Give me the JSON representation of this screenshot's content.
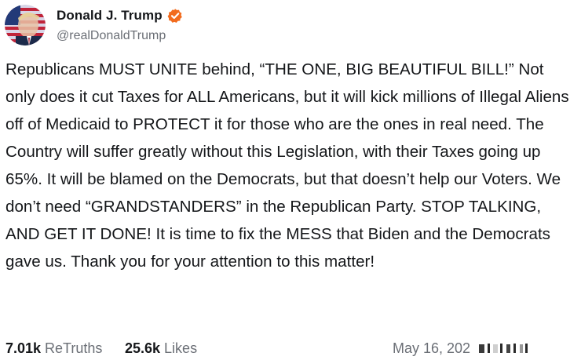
{
  "author": {
    "display_name": "Donald J. Trump",
    "handle": "@realDonaldTrump",
    "verified_icon": "verified-badge-icon",
    "verified_color": "#f26b1d"
  },
  "post": {
    "text": "Republicans MUST UNITE behind, “THE ONE, BIG BEAUTIFUL BILL!” Not only does it cut Taxes for ALL Americans, but it will kick millions of Illegal Aliens off of Medicaid to PROTECT it for those who are the ones in real need. The Country will suffer greatly without this Legislation, with their Taxes going up 65%. It will be blamed on the Democrats, but that doesn’t help our Voters. We don’t need “GRANDSTANDERS” in the Republican Party. STOP TALKING, AND GET IT DONE! It is time to fix the MESS that Biden and the Democrats gave us. Thank you for your attention to this matter!"
  },
  "stats": {
    "retruths_count": "7.01k",
    "retruths_label": "ReTruths",
    "likes_count": "25.6k",
    "likes_label": "Likes"
  },
  "timestamp": "May 16, 202"
}
